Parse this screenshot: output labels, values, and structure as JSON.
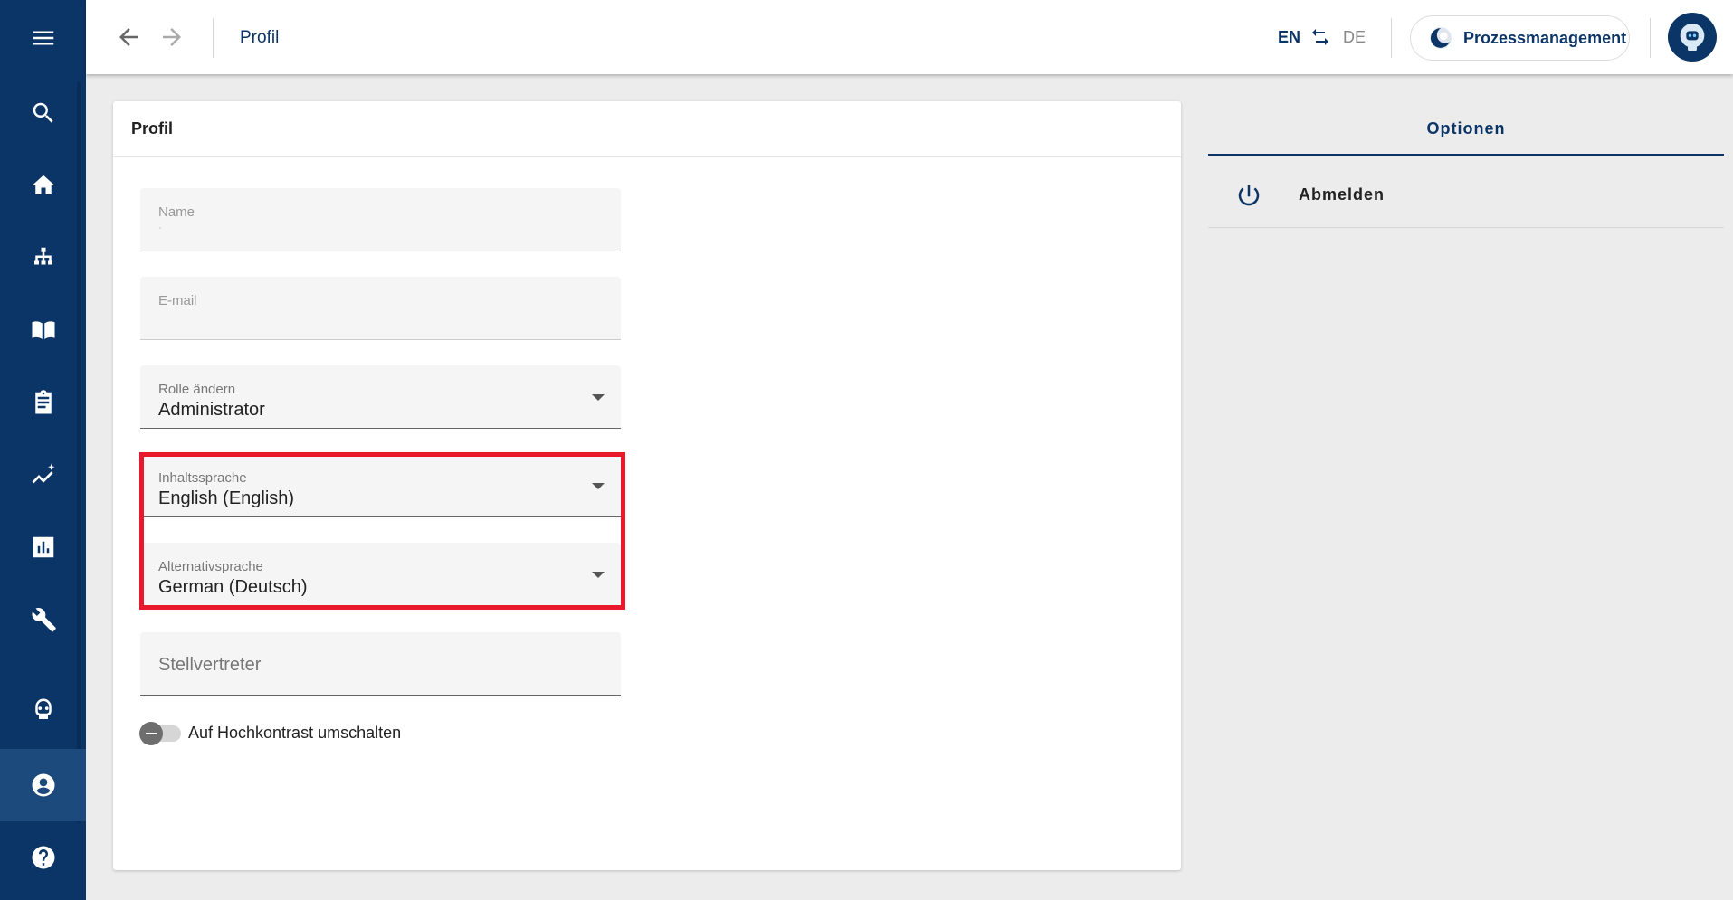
{
  "sidebar": {
    "items": [
      {
        "name": "menu-icon"
      },
      {
        "name": "search-icon"
      },
      {
        "name": "home-icon"
      },
      {
        "name": "sitemap-icon"
      },
      {
        "name": "book-icon"
      },
      {
        "name": "clipboard-icon"
      },
      {
        "name": "analytics-icon"
      },
      {
        "name": "chart-icon"
      },
      {
        "name": "wrench-icon"
      },
      {
        "name": "robot-icon"
      },
      {
        "name": "account-icon",
        "active": true
      },
      {
        "name": "help-icon"
      }
    ]
  },
  "topbar": {
    "title": "Profil",
    "lang_active": "EN",
    "lang_other": "DE",
    "app_button": "Prozessmanagement"
  },
  "card": {
    "title": "Profil",
    "fields": {
      "name_label": "Name",
      "name_value": "·",
      "email_label": "E-mail",
      "role_label": "Rolle ändern",
      "role_value": "Administrator",
      "content_lang_label": "Inhaltssprache",
      "content_lang_value": "English (English)",
      "alt_lang_label": "Alternativsprache",
      "alt_lang_value": "German (Deutsch)",
      "deputy_placeholder": "Stellvertreter"
    },
    "toggle_label": "Auf Hochkontrast umschalten"
  },
  "options": {
    "title": "Optionen",
    "logout_label": "Abmelden"
  },
  "colors": {
    "primary": "#0c3567",
    "highlight": "#e8192c"
  }
}
